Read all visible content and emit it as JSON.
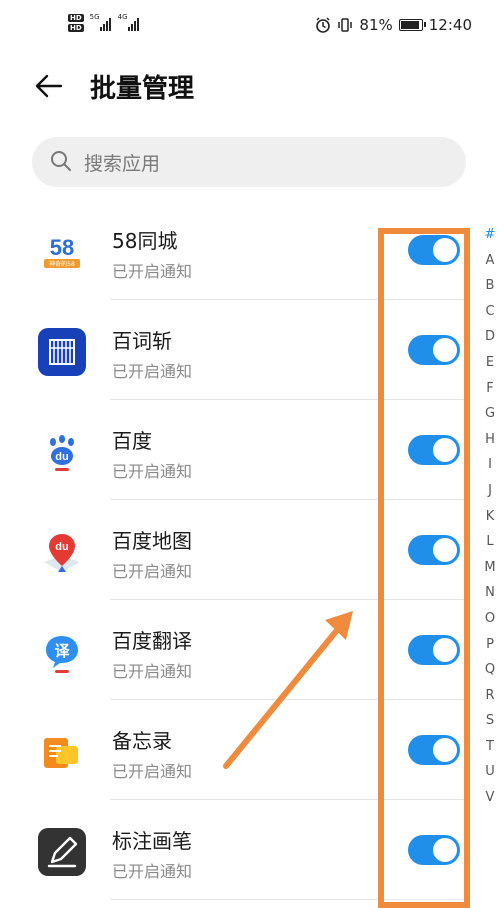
{
  "status_bar": {
    "hd1": "HD",
    "hd2": "HD",
    "net1": "5G",
    "net2": "4G",
    "battery": "81%",
    "time": "12:40"
  },
  "header": {
    "title": "批量管理"
  },
  "search": {
    "placeholder": "搜索应用"
  },
  "apps": [
    {
      "name": "58同城",
      "status": "已开启通知",
      "icon": "58-tongcheng-icon",
      "enabled": true
    },
    {
      "name": "百词斩",
      "status": "已开启通知",
      "icon": "baicizhan-icon",
      "enabled": true
    },
    {
      "name": "百度",
      "status": "已开启通知",
      "icon": "baidu-icon",
      "enabled": true
    },
    {
      "name": "百度地图",
      "status": "已开启通知",
      "icon": "baidu-map-icon",
      "enabled": true
    },
    {
      "name": "百度翻译",
      "status": "已开启通知",
      "icon": "baidu-translate-icon",
      "enabled": true
    },
    {
      "name": "备忘录",
      "status": "已开启通知",
      "icon": "memo-icon",
      "enabled": true
    },
    {
      "name": "标注画笔",
      "status": "已开启通知",
      "icon": "annotation-pen-icon",
      "enabled": true
    }
  ],
  "index_letters": [
    "#",
    "A",
    "B",
    "C",
    "D",
    "E",
    "F",
    "G",
    "H",
    "I",
    "J",
    "K",
    "L",
    "M",
    "N",
    "O",
    "P",
    "Q",
    "R",
    "S",
    "T",
    "U",
    "V"
  ],
  "icon_58_text": "58",
  "icon_58_sub": "神奇的58",
  "icon_du_text": "du",
  "icon_trans_text": "译",
  "colors": {
    "accent": "#1f8fea",
    "annotation": "#f08a3c"
  }
}
